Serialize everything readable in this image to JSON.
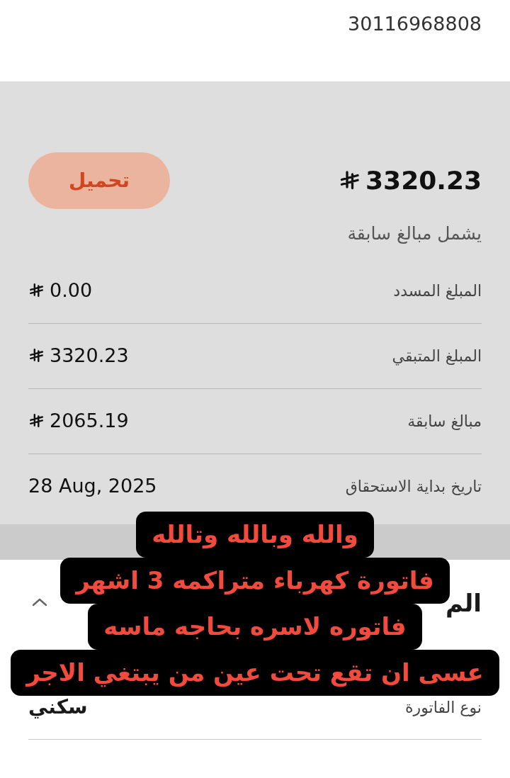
{
  "account_number": "30116968808",
  "summary": {
    "amount": "3320.23",
    "note": "يشمل مبالغ سابقة",
    "download_button": "تحميل"
  },
  "details": [
    {
      "label": "المبلغ المسدد",
      "value": "0.00",
      "kind": "money"
    },
    {
      "label": "المبلغ المتبقي",
      "value": "3320.23",
      "kind": "money"
    },
    {
      "label": "مبالغ سابقة",
      "value": "2065.19",
      "kind": "money"
    },
    {
      "label": "تاريخ بداية الاستحقاق",
      "value": "28 Aug, 2025",
      "kind": "date"
    }
  ],
  "section": {
    "title": "الم",
    "expanded": true
  },
  "bill_rows": [
    {
      "label": "نوع الفاتورة",
      "value": "سكني"
    }
  ],
  "caption_lines": [
    "والله وبالله وتالله",
    "فاتورة كهرباء متراكمه 3 اشهر",
    "فاتوره لاسره بحاجه ماسه",
    "عسى ان تقع تحت عين من يبتغي الاجر"
  ]
}
